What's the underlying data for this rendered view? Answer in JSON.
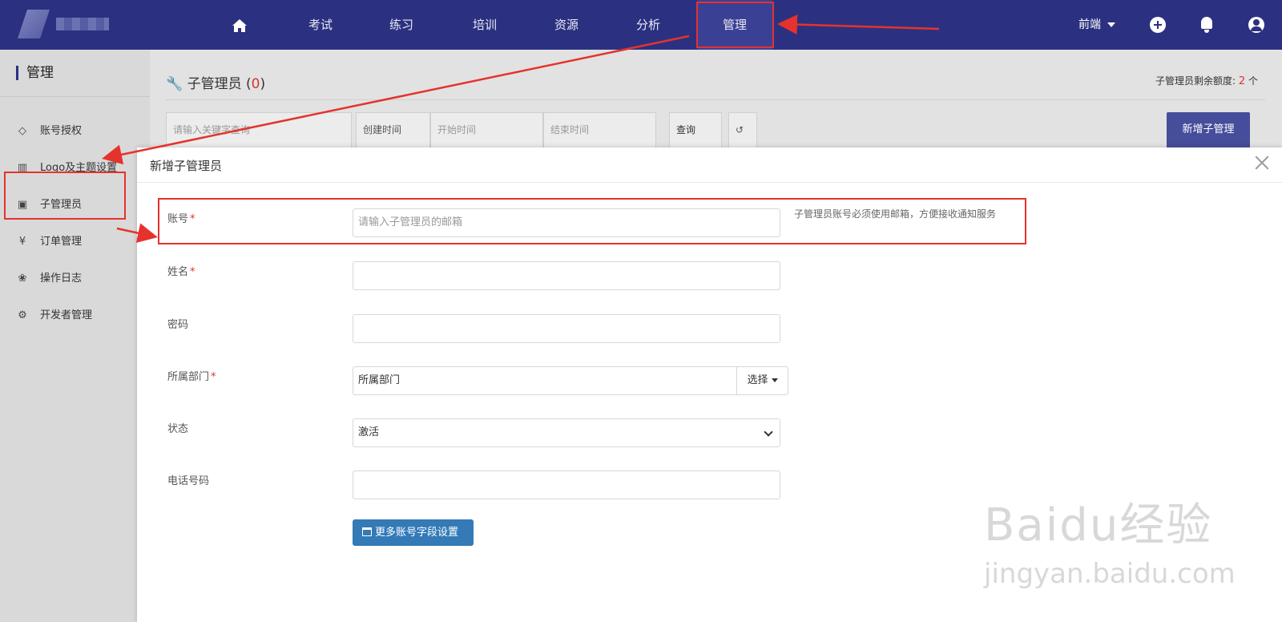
{
  "topnav": {
    "items": [
      "考试",
      "练习",
      "培训",
      "资源",
      "分析",
      "管理"
    ],
    "active": "管理",
    "dropdown_label": "前端"
  },
  "sidebar": {
    "title": "管理",
    "items": [
      {
        "label": "账号授权",
        "icon": "diamond-icon"
      },
      {
        "label": "Logo及主题设置",
        "icon": "bank-icon"
      },
      {
        "label": "子管理员",
        "icon": "id-card-icon"
      },
      {
        "label": "订单管理",
        "icon": "yen-icon"
      },
      {
        "label": "操作日志",
        "icon": "paw-icon"
      },
      {
        "label": "开发者管理",
        "icon": "cogs-icon"
      }
    ]
  },
  "main": {
    "title": "子管理员",
    "count": "0",
    "quota_label": "子管理员剩余额度:",
    "quota_value": "2",
    "quota_unit": "个",
    "search_placeholder": "请输入关键字查询",
    "created_time_label": "创建时间",
    "start_time_placeholder": "开始时间",
    "end_time_placeholder": "结束时间",
    "query_label": "查询",
    "add_admin_label": "新增子管理"
  },
  "modal": {
    "title": "新增子管理员",
    "account_label": "账号",
    "account_placeholder": "请输入子管理员的邮箱",
    "account_hint": "子管理员账号必须使用邮箱，方便接收通知服务",
    "name_label": "姓名",
    "password_label": "密码",
    "dept_label": "所属部门",
    "dept_value": "所属部门",
    "select_label": "选择",
    "status_label": "状态",
    "status_value": "激活",
    "phone_label": "电话号码",
    "more_fields_label": "更多账号字段设置"
  },
  "watermark": {
    "main": "Baidu经验",
    "sub": "jingyan.baidu.com"
  },
  "colors": {
    "nav_bg": "#2b3180",
    "accent_red": "#e5322d",
    "primary_button": "#337ab7"
  }
}
